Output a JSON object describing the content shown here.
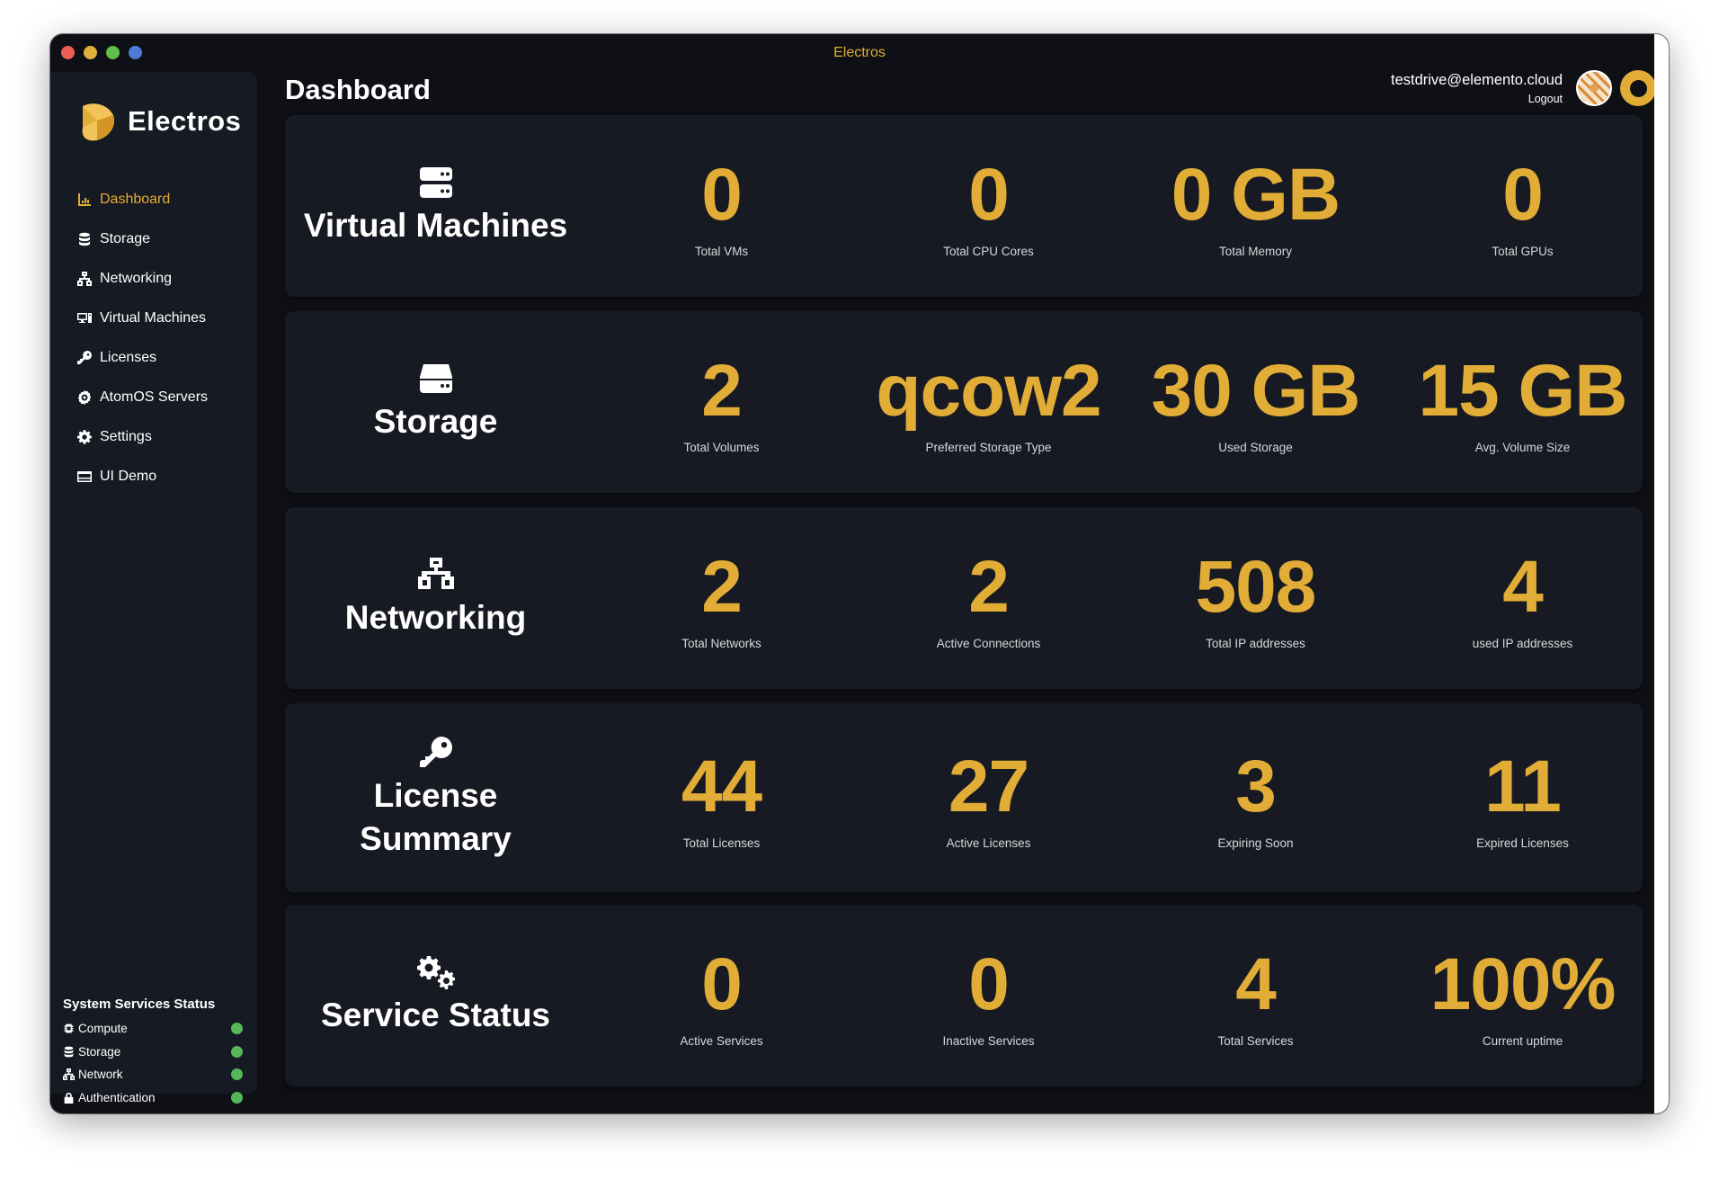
{
  "window": {
    "title": "Electros"
  },
  "brand": {
    "name": "Electros",
    "logo_icon": "electros-logo-icon"
  },
  "page": {
    "title": "Dashboard"
  },
  "user": {
    "email": "testdrive@elemento.cloud",
    "logout_label": "Logout"
  },
  "colors": {
    "accent": "#e2ad36",
    "background": "#0e1016",
    "card": "#171a22",
    "status_ok": "#58b65a"
  },
  "sidebar": {
    "items": [
      {
        "label": "Dashboard",
        "icon": "chart-icon",
        "active": true
      },
      {
        "label": "Storage",
        "icon": "database-icon"
      },
      {
        "label": "Networking",
        "icon": "network-icon"
      },
      {
        "label": "Virtual Machines",
        "icon": "desktop-icon"
      },
      {
        "label": "Licenses",
        "icon": "key-icon"
      },
      {
        "label": "AtomOS Servers",
        "icon": "atom-icon"
      },
      {
        "label": "Settings",
        "icon": "gear-icon"
      },
      {
        "label": "UI Demo",
        "icon": "window-icon"
      }
    ]
  },
  "services": {
    "title": "System Services Status",
    "items": [
      {
        "label": "Compute",
        "icon": "chip-icon",
        "status": "ok"
      },
      {
        "label": "Storage",
        "icon": "database-icon",
        "status": "ok"
      },
      {
        "label": "Network",
        "icon": "network-icon",
        "status": "ok"
      },
      {
        "label": "Authentication",
        "icon": "lock-icon",
        "status": "ok"
      }
    ]
  },
  "cards": [
    {
      "title": "Virtual Machines",
      "icon": "server-icon",
      "stats": [
        {
          "value": "0",
          "label": "Total VMs"
        },
        {
          "value": "0",
          "label": "Total CPU Cores"
        },
        {
          "value": "0 GB",
          "label": "Total Memory"
        },
        {
          "value": "0",
          "label": "Total GPUs"
        }
      ]
    },
    {
      "title": "Storage",
      "icon": "hard-drive-icon",
      "stats": [
        {
          "value": "2",
          "label": "Total Volumes"
        },
        {
          "value": "qcow2",
          "label": "Preferred Storage Type"
        },
        {
          "value": "30 GB",
          "label": "Used Storage"
        },
        {
          "value": "15 GB",
          "label": "Avg. Volume Size"
        }
      ]
    },
    {
      "title": "Networking",
      "icon": "network-icon",
      "stats": [
        {
          "value": "2",
          "label": "Total Networks"
        },
        {
          "value": "2",
          "label": "Active Connections"
        },
        {
          "value": "508",
          "label": "Total IP addresses"
        },
        {
          "value": "4",
          "label": "used IP addresses"
        }
      ]
    },
    {
      "title": "License Summary",
      "icon": "key-icon",
      "stats": [
        {
          "value": "44",
          "label": "Total Licenses"
        },
        {
          "value": "27",
          "label": "Active Licenses"
        },
        {
          "value": "3",
          "label": "Expiring Soon"
        },
        {
          "value": "11",
          "label": "Expired Licenses"
        }
      ]
    },
    {
      "title": "Service Status",
      "icon": "gears-icon",
      "stats": [
        {
          "value": "0",
          "label": "Active Services"
        },
        {
          "value": "0",
          "label": "Inactive Services"
        },
        {
          "value": "4",
          "label": "Total Services"
        },
        {
          "value": "100%",
          "label": "Current uptime"
        }
      ]
    }
  ]
}
